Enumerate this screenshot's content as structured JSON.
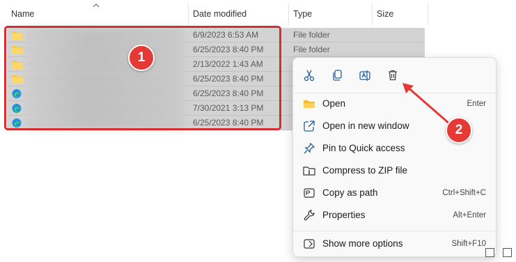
{
  "columns": {
    "name": "Name",
    "date_modified": "Date modified",
    "type": "Type",
    "size": "Size"
  },
  "rows": [
    {
      "icon": "folder-icon",
      "date": "6/9/2023 6:53 AM",
      "type": "File folder"
    },
    {
      "icon": "folder-icon",
      "date": "6/25/2023 8:40 PM",
      "type": "File folder"
    },
    {
      "icon": "folder-icon",
      "date": "2/13/2022 1:43 AM",
      "type": ""
    },
    {
      "icon": "folder-icon",
      "date": "6/25/2023 8:40 PM",
      "type": ""
    },
    {
      "icon": "edge-icon",
      "date": "6/25/2023 8:40 PM",
      "type": ""
    },
    {
      "icon": "edge-icon",
      "date": "7/30/2021 3:13 PM",
      "type": ""
    },
    {
      "icon": "edge-icon",
      "date": "6/25/2023 8:40 PM",
      "type": ""
    }
  ],
  "annotations": {
    "badge_1": "1",
    "badge_2": "2",
    "accent_color": "#e53935"
  },
  "context_menu": {
    "quick_actions": [
      {
        "name": "cut",
        "icon": "scissors-icon"
      },
      {
        "name": "copy",
        "icon": "copy-icon"
      },
      {
        "name": "rename",
        "icon": "rename-icon"
      },
      {
        "name": "delete",
        "icon": "trash-icon"
      }
    ],
    "items": [
      {
        "label": "Open",
        "shortcut": "Enter",
        "icon": "folder-open-icon"
      },
      {
        "label": "Open in new window",
        "shortcut": "",
        "icon": "new-window-icon"
      },
      {
        "label": "Pin to Quick access",
        "shortcut": "",
        "icon": "pin-icon"
      },
      {
        "label": "Compress to ZIP file",
        "shortcut": "",
        "icon": "zip-icon"
      },
      {
        "label": "Copy as path",
        "shortcut": "Ctrl+Shift+C",
        "icon": "path-icon"
      },
      {
        "label": "Properties",
        "shortcut": "Alt+Enter",
        "icon": "wrench-icon"
      },
      {
        "label": "Show more options",
        "shortcut": "Shift+F10",
        "icon": "more-options-icon"
      }
    ]
  }
}
